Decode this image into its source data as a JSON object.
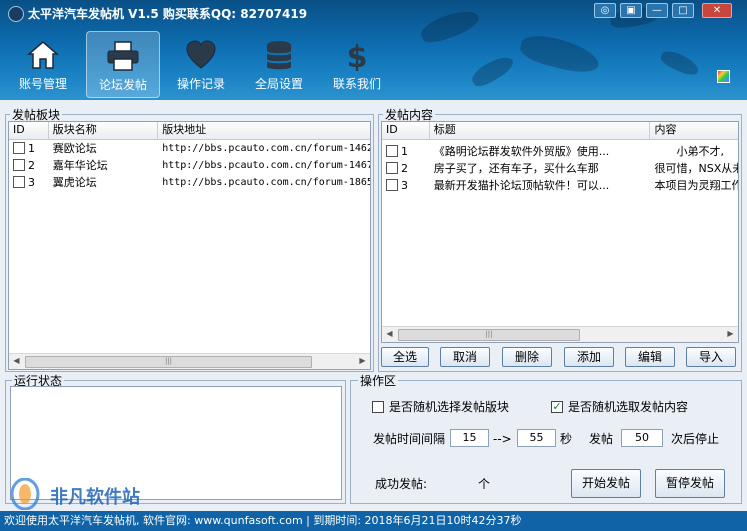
{
  "window": {
    "title": "太平洋汽车发帖机 V1.5 购买联系QQ: 82707419"
  },
  "nav": [
    {
      "label": "账号管理",
      "icon": "house-icon"
    },
    {
      "label": "论坛发帖",
      "icon": "printer-icon"
    },
    {
      "label": "操作记录",
      "icon": "heart-icon"
    },
    {
      "label": "全局设置",
      "icon": "coin-stack-icon"
    },
    {
      "label": "联系我们",
      "icon": "dollar-icon"
    }
  ],
  "boards": {
    "title": "发帖板块",
    "columns": [
      "ID",
      "版块名称",
      "版块地址"
    ],
    "rows": [
      {
        "id": "1",
        "name": "赛欧论坛",
        "url": "http://bbs.pcauto.com.cn/forum-1462"
      },
      {
        "id": "2",
        "name": "嘉年华论坛",
        "url": "http://bbs.pcauto.com.cn/forum-1467"
      },
      {
        "id": "3",
        "name": "翼虎论坛",
        "url": "http://bbs.pcauto.com.cn/forum-1865"
      }
    ]
  },
  "posts": {
    "title": "发帖内容",
    "columns": [
      "ID",
      "标题",
      "内容"
    ],
    "rows": [
      {
        "id": "1",
        "title": "《路明论坛群发软件外贸版》使用...",
        "content": "　　小弟不才,"
      },
      {
        "id": "2",
        "title": "房子买了，还有车子，买什么车那",
        "content": "很可惜，NSX从未"
      },
      {
        "id": "3",
        "title": "最新开发猫扑论坛顶帖软件！可以...",
        "content": "本项目为灵翔工作"
      }
    ],
    "buttons": [
      "全选",
      "取消",
      "删除",
      "添加",
      "编辑",
      "导入"
    ]
  },
  "run_status": {
    "title": "运行状态"
  },
  "ops": {
    "title": "操作区",
    "random_board_label": "是否随机选择发帖版块",
    "random_board_checked": false,
    "random_content_label": "是否随机选取发帖内容",
    "random_content_checked": true,
    "interval_label": "发帖时间间隔",
    "interval_min": "15",
    "interval_arrow": "-->",
    "interval_max": "55",
    "seconds_label": "秒",
    "post_label": "发帖",
    "post_count": "50",
    "stop_label": "次后停止",
    "success_label": "成功发帖:",
    "success_unit": "个",
    "start_button": "开始发帖",
    "pause_button": "暂停发帖"
  },
  "statusbar": {
    "text": "欢迎使用太平洋汽车发帖机, 软件官网: www.qunfasoft.com  | 到期时间: 2018年6月21日10时42分37秒"
  },
  "watermark": {
    "text": "非凡软件站"
  },
  "colors": {
    "titlebar": "#0d6db0",
    "statusbar": "#0f63a6",
    "close_button": "#c9463d"
  }
}
